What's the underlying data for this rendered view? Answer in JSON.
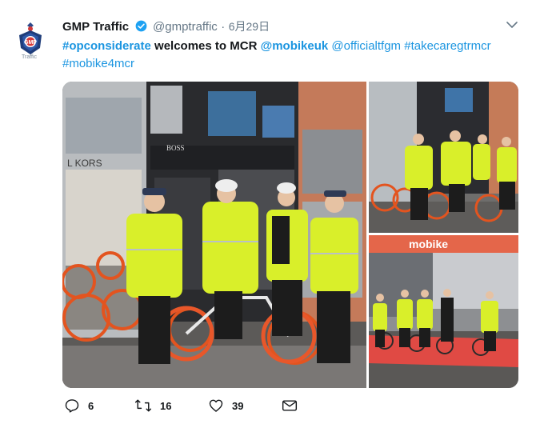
{
  "user": {
    "name": "GMP Traffic",
    "handle": "@gmptraffic",
    "separator": "·",
    "date": "6月29日",
    "avatar_caption": "Traffic"
  },
  "tweet": {
    "segments": [
      {
        "text": "#opconsiderate",
        "style": "tag"
      },
      {
        "text": " welcomes to MCR ",
        "style": "plain"
      },
      {
        "text": "@mobikeuk",
        "style": "tag"
      },
      {
        "text": " ",
        "style": "plain"
      },
      {
        "text": "@officialtfgm",
        "style": "tag-light"
      },
      {
        "text": " ",
        "style": "plain"
      },
      {
        "text": "#takecaregtrmcr",
        "style": "tag-light"
      },
      {
        "text": " ",
        "style": "plain"
      },
      {
        "text": "#mobike4mcr",
        "style": "tag-light"
      }
    ]
  },
  "photos": {
    "main": {
      "sign_left": "L KORS",
      "sign_boss": "BOSS"
    },
    "bottom_right": {
      "banner": "mobike"
    }
  },
  "actions": {
    "reply_count": "6",
    "retweet_count": "16",
    "like_count": "39"
  },
  "colors": {
    "link": "#1b95e0",
    "hiviz": "#d9ef2a",
    "bike_orange": "#ee5a2a",
    "text_secondary": "#657786"
  },
  "icons": [
    "police-badge-icon",
    "verified-icon",
    "chevron-down-icon",
    "reply-icon",
    "retweet-icon",
    "like-icon",
    "message-icon"
  ]
}
